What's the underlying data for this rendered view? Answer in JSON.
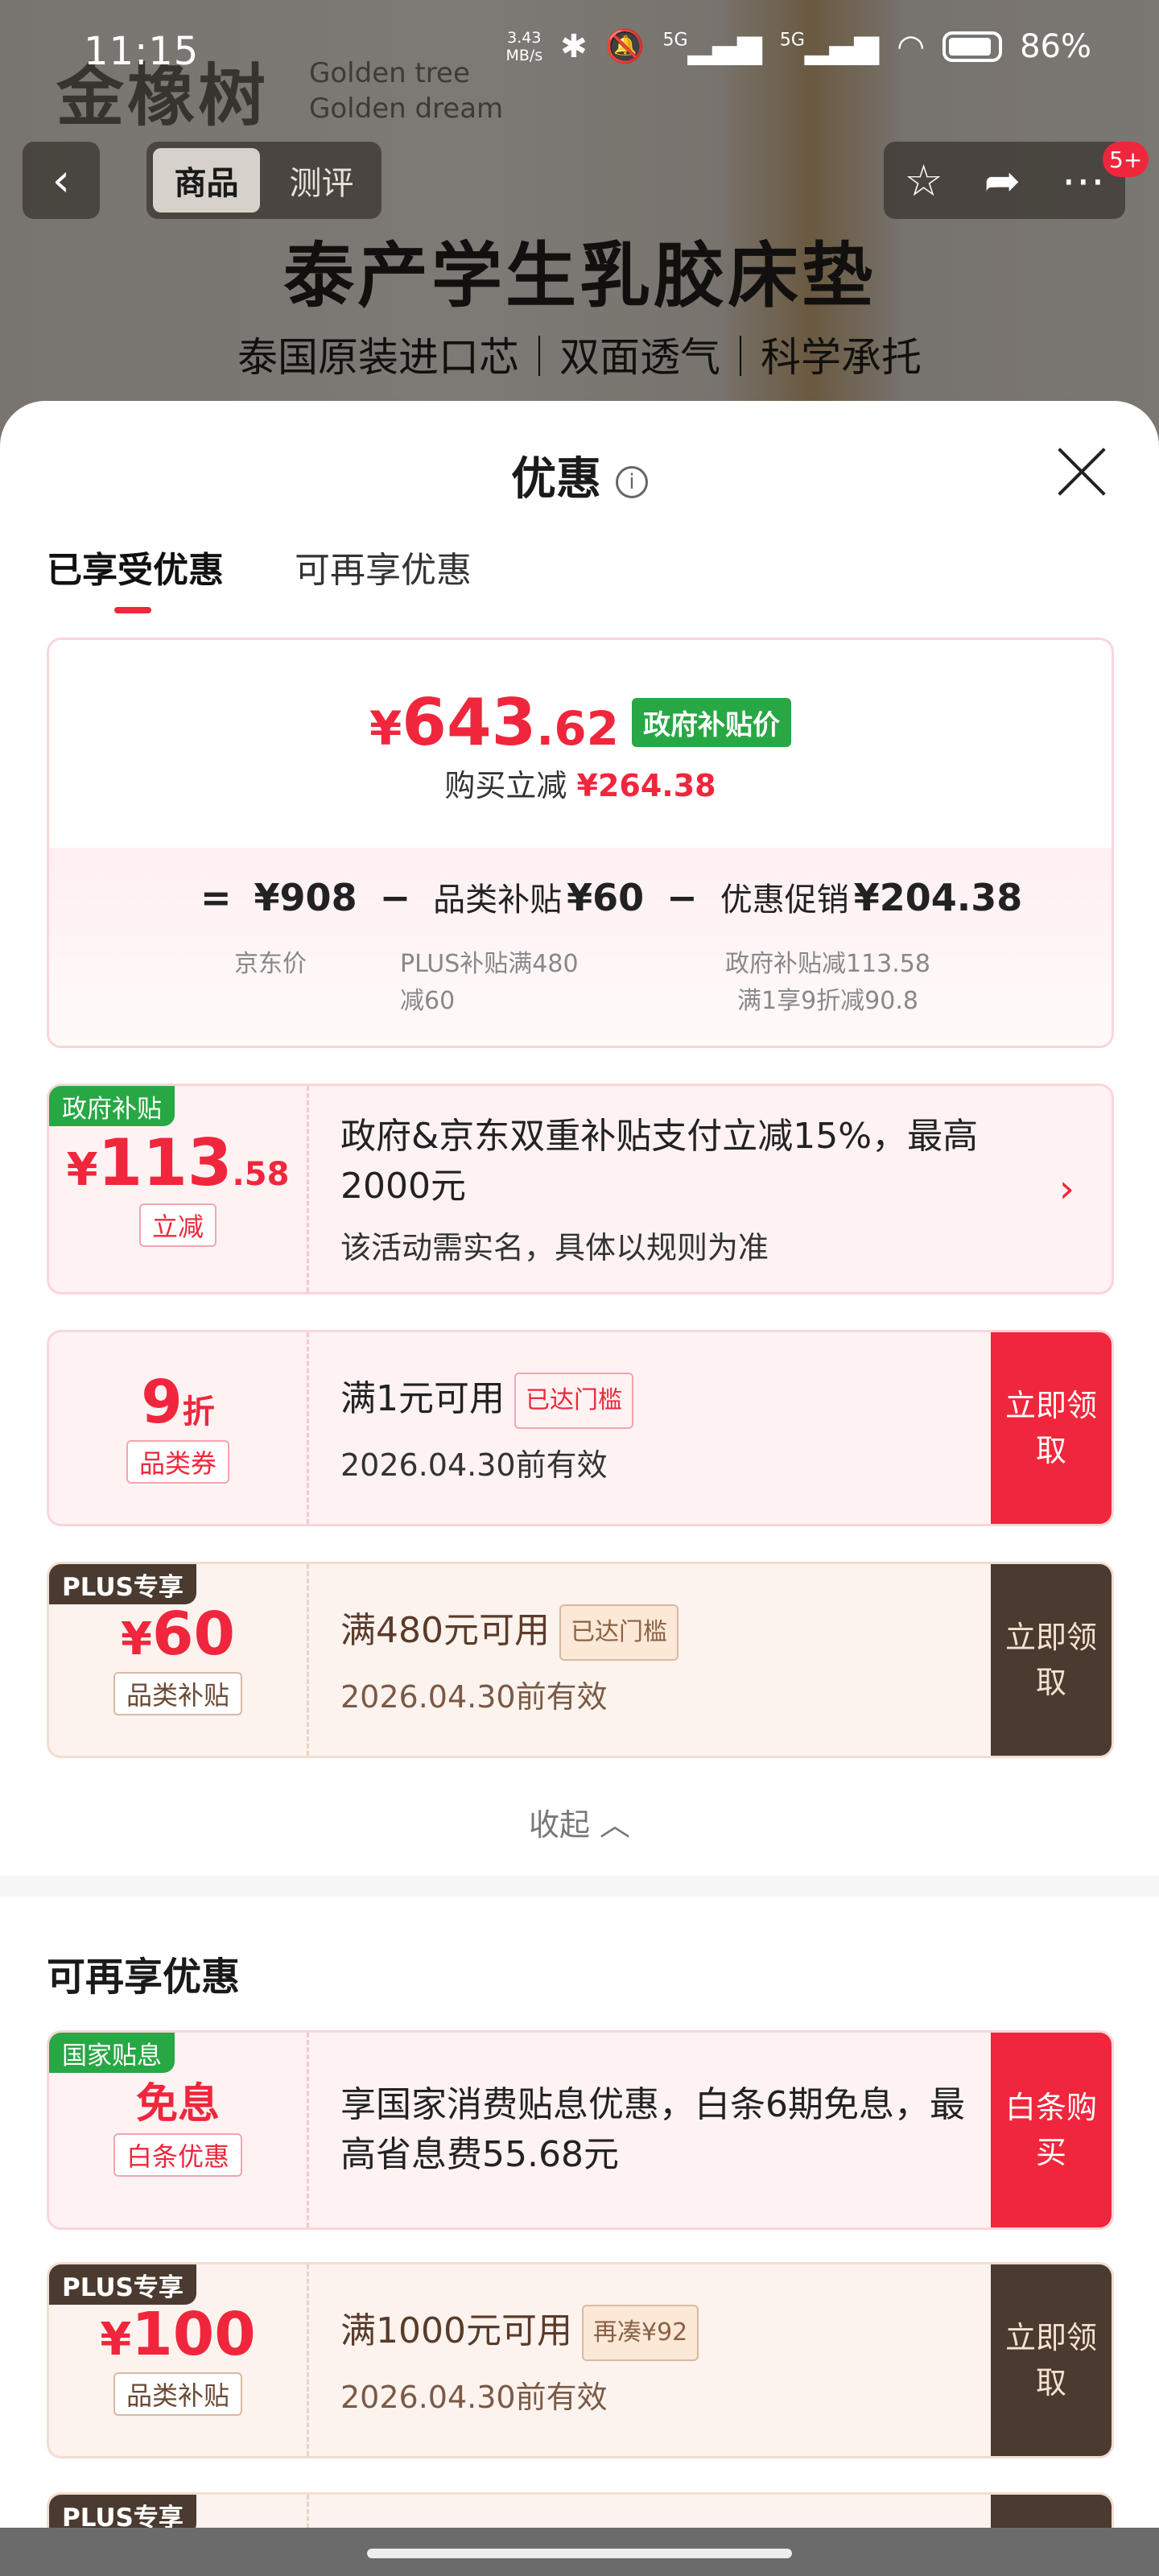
{
  "status_bar": {
    "time": "11:15",
    "net_speed": "3.43",
    "net_unit": "MB/s",
    "battery": "86%",
    "signal1": "5G",
    "signal2": "5G"
  },
  "background": {
    "brand_cn": "金橡树",
    "brand_en_1": "Golden tree",
    "brand_en_2": "Golden dream",
    "hero_title": "泰产学生乳胶床垫",
    "hero_sub": "泰国原装进口芯｜双面透气｜科学承托"
  },
  "nav": {
    "tab_product": "商品",
    "tab_review": "测评",
    "badge": "5+"
  },
  "sheet": {
    "title": "优惠",
    "tabs": [
      "已享受优惠",
      "可再享优惠"
    ]
  },
  "price": {
    "currency": "¥",
    "int": "643",
    "dec": ".62",
    "tag": "政府补贴价",
    "reduce_label": "购买立减",
    "reduce_value": "¥264.38",
    "formula": {
      "eq": "=",
      "jd_price": "¥908",
      "minus": "−",
      "category_label": "品类补贴",
      "category_value": "¥60",
      "promo_label": "优惠促销",
      "promo_value": "¥204.38",
      "note_jd": "京东价",
      "note_plus_1": "PLUS补贴满480",
      "note_plus_2": "减60",
      "note_gov_1": "政府补贴减113.58",
      "note_gov_2": "满1享9折减90.8"
    }
  },
  "coupons": [
    {
      "corner": "政府补贴",
      "currency": "¥",
      "amount_int": "113",
      "amount_dec": ".58",
      "pill": "立减",
      "line1": "政府&京东双重补贴支付立减15%，最高2000元",
      "line2": "该活动需实名，具体以规则为准"
    },
    {
      "amount": "9",
      "unit": "折",
      "pill": "品类券",
      "line1": "满1元可用",
      "tag": "已达门槛",
      "line2": "2026.04.30前有效",
      "button": "立即领取"
    },
    {
      "corner": "PLUS专享",
      "currency": "¥",
      "amount": "60",
      "pill": "品类补贴",
      "line1": "满480元可用",
      "tag": "已达门槛",
      "line2": "2026.04.30前有效",
      "button": "立即领取"
    }
  ],
  "collapse_label": "收起",
  "more_section": {
    "title": "可再享优惠",
    "coupons": [
      {
        "corner": "国家贴息",
        "amount": "免息",
        "pill": "白条优惠",
        "line1": "享国家消费贴息优惠，白条6期免息，最高省息费55.68元",
        "button": "白条购买"
      },
      {
        "corner": "PLUS专享",
        "currency": "¥",
        "amount": "100",
        "pill": "品类补贴",
        "line1": "满1000元可用",
        "tag": "再凑¥92",
        "line2": "2026.04.30前有效",
        "button": "立即领取"
      },
      {
        "corner": "PLUS专享"
      }
    ]
  },
  "colors": {
    "accent_red": "#f0263c",
    "gov_green": "#28a745",
    "plus_dark": "#4a3a30"
  }
}
